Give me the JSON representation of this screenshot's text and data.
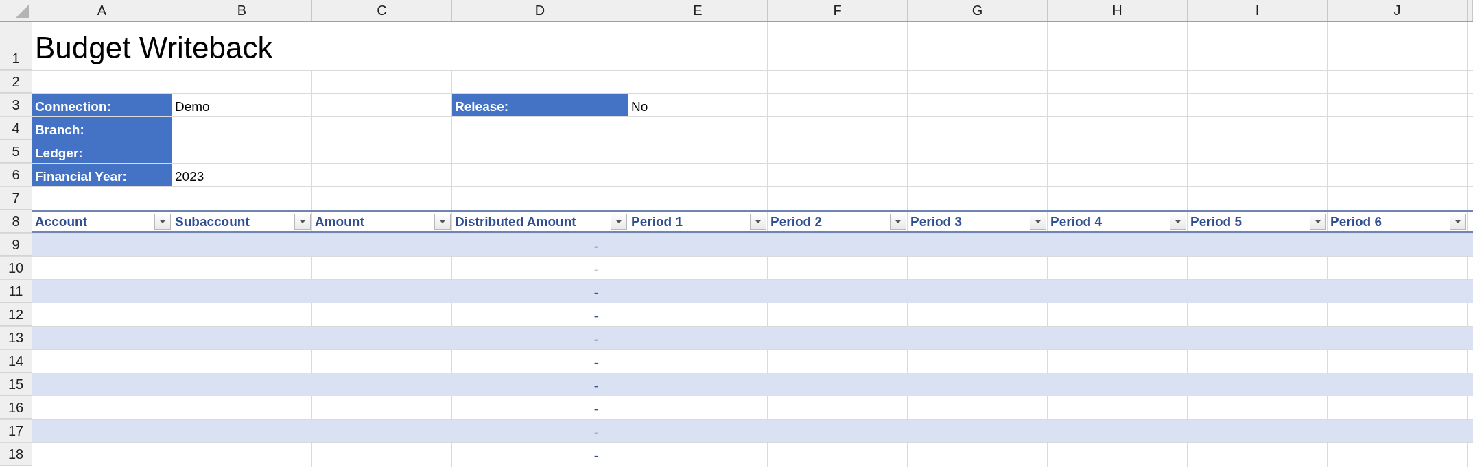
{
  "column_headers": [
    "A",
    "B",
    "C",
    "D",
    "E",
    "F",
    "G",
    "H",
    "I",
    "J"
  ],
  "row_numbers": [
    "1",
    "2",
    "3",
    "4",
    "5",
    "6",
    "7",
    "8",
    "9",
    "10",
    "11",
    "12",
    "13",
    "14",
    "15",
    "16",
    "17",
    "18"
  ],
  "title": "Budget Writeback",
  "info_fields": [
    {
      "label": "Connection:",
      "value": "Demo"
    },
    {
      "label": "Branch:"
    },
    {
      "label": "Ledger:"
    },
    {
      "label": "Financial Year:",
      "value": "2023"
    }
  ],
  "release": {
    "label": "Release:",
    "value": "No"
  },
  "table": {
    "columns": [
      "Account",
      "Subaccount",
      "Amount",
      "Distributed Amount",
      "Period 1",
      "Period 2",
      "Period 3",
      "Period 4",
      "Period 5",
      "Period 6"
    ],
    "rows": [
      {
        "distributed_amount": "-"
      },
      {
        "distributed_amount": "-"
      },
      {
        "distributed_amount": "-"
      },
      {
        "distributed_amount": "-"
      },
      {
        "distributed_amount": "-"
      },
      {
        "distributed_amount": "-"
      },
      {
        "distributed_amount": "-"
      },
      {
        "distributed_amount": "-"
      },
      {
        "distributed_amount": "-"
      },
      {
        "distributed_amount": "-"
      }
    ]
  }
}
